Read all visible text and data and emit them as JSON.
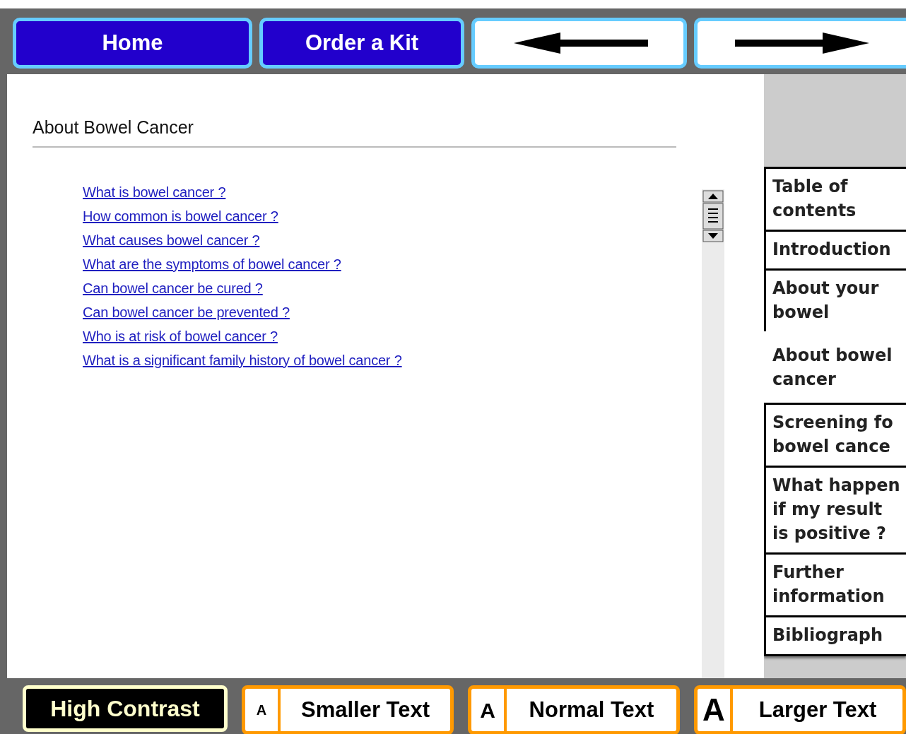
{
  "nav_buttons": [
    {
      "kind": "text",
      "label": "Home"
    },
    {
      "kind": "text",
      "label": "Order a Kit"
    },
    {
      "kind": "back"
    },
    {
      "kind": "forward"
    }
  ],
  "heading": "About Bowel Cancer",
  "links": [
    "What is bowel cancer ?",
    "How common is bowel cancer ?",
    "What causes bowel cancer ?",
    "What are the symptoms of bowel cancer ?",
    "Can bowel cancer be cured ?",
    "Can bowel cancer be prevented ?",
    "Who is at risk of bowel cancer ?",
    "What is a significant family history of bowel cancer ?"
  ],
  "tabs": [
    {
      "label": "Table of\ncontents",
      "selected": false
    },
    {
      "label": "Introduction",
      "selected": false
    },
    {
      "label": "About your\nbowel",
      "selected": false
    },
    {
      "label": "About bowel\ncancer",
      "selected": true
    },
    {
      "label": "Screening fo\nbowel cance",
      "selected": false
    },
    {
      "label": "What happen\nif my result\nis positive ?",
      "selected": false
    },
    {
      "label": "Further\ninformation",
      "selected": false
    },
    {
      "label": "Bibliograph",
      "selected": false
    }
  ],
  "high_contrast": {
    "label": "High Contrast"
  },
  "text_size_buttons": [
    {
      "kind": "small",
      "letter": "A",
      "label": "Smaller Text"
    },
    {
      "kind": "normal",
      "letter": "A",
      "label": "Normal Text"
    },
    {
      "kind": "large",
      "letter": "A",
      "label": "Larger Text"
    }
  ]
}
